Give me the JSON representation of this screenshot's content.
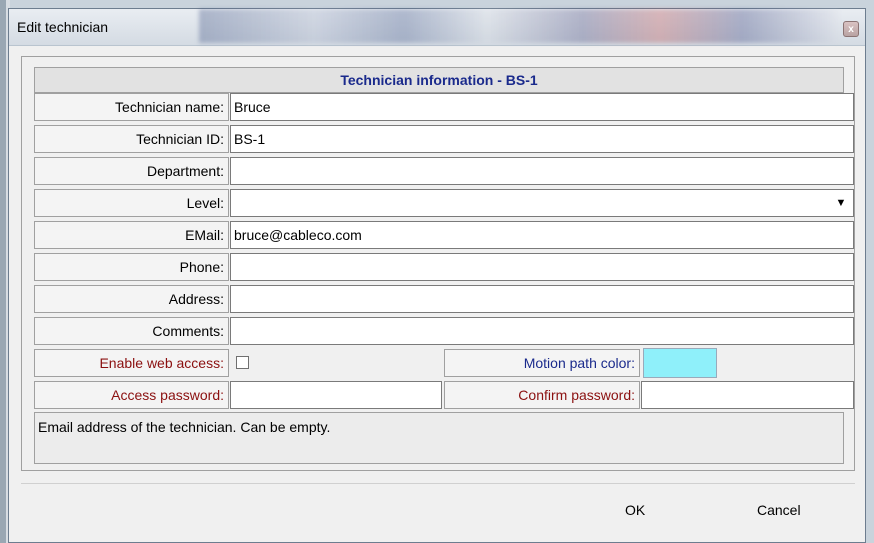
{
  "window": {
    "title": "Edit technician",
    "close_glyph": "x"
  },
  "form": {
    "header": "Technician information - BS-1",
    "fields": {
      "name": {
        "label": "Technician name:",
        "value": "Bruce"
      },
      "id": {
        "label": "Technician ID:",
        "value": "BS-1"
      },
      "department": {
        "label": "Department:",
        "value": ""
      },
      "level": {
        "label": "Level:",
        "value": ""
      },
      "email": {
        "label": "EMail:",
        "value": "bruce@cableco.com"
      },
      "phone": {
        "label": "Phone:",
        "value": ""
      },
      "address": {
        "label": "Address:",
        "value": ""
      },
      "comments": {
        "label": "Comments:",
        "value": ""
      }
    },
    "web_access": {
      "label": "Enable web access:",
      "checked": false
    },
    "motion_path": {
      "label": "Motion path color:",
      "color": "#8ff0fa"
    },
    "access_password": {
      "label": "Access password:",
      "value": ""
    },
    "confirm_password": {
      "label": "Confirm password:",
      "value": ""
    },
    "help_text": "Email address of the technician. Can be empty."
  },
  "buttons": {
    "ok": "OK",
    "cancel": "Cancel"
  },
  "colors": {
    "header_text": "#1a2a8c",
    "red_label": "#8b1010",
    "blue_label": "#1a2a8c"
  }
}
